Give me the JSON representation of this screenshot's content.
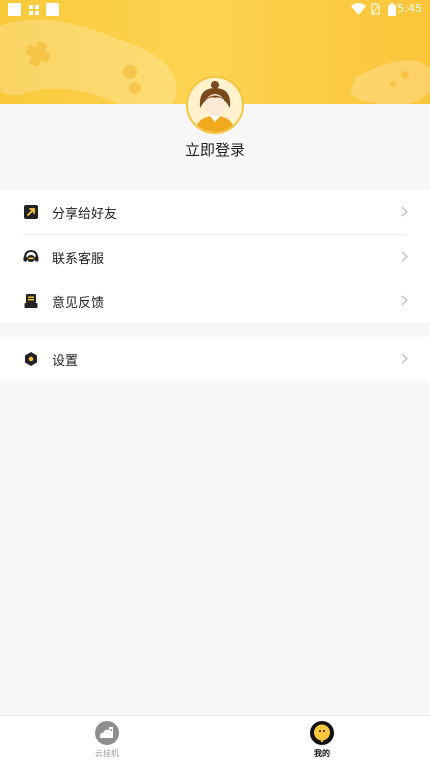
{
  "status_bar": {
    "time": "5:45",
    "icons": [
      "notification-icon",
      "sim-icon",
      "notification-icon",
      "wifi-icon",
      "no-sim-icon",
      "battery-icon"
    ]
  },
  "profile": {
    "login_text": "立即登录",
    "avatar_icon": "user-avatar"
  },
  "menu": {
    "group1": [
      {
        "label": "分享给好友",
        "icon": "share-icon"
      },
      {
        "label": "联系客服",
        "icon": "headset-icon"
      },
      {
        "label": "意见反馈",
        "icon": "feedback-icon"
      }
    ],
    "group2": [
      {
        "label": "设置",
        "icon": "settings-icon"
      }
    ]
  },
  "tabbar": {
    "tabs": [
      {
        "label": "云挂机",
        "icon": "cloud-device-icon",
        "active": false
      },
      {
        "label": "我的",
        "icon": "profile-face-icon",
        "active": true
      }
    ]
  },
  "colors": {
    "accent": "#fbc93a",
    "background": "#f7f7f7",
    "text": "#222222",
    "muted": "#999999"
  }
}
